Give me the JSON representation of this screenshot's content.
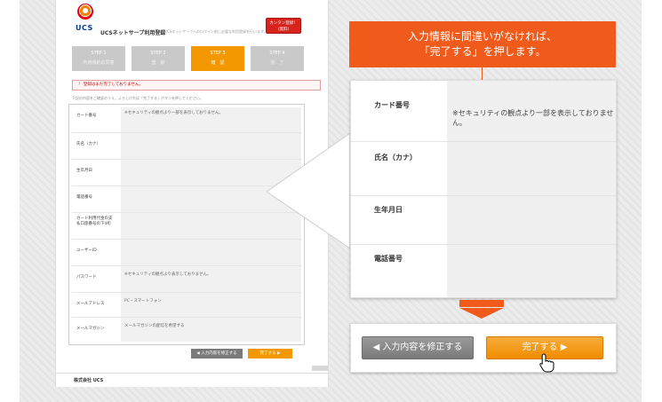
{
  "callout": {
    "line1": "入力情報に間違いがなければ、",
    "line2": "「完了する」を押します。"
  },
  "mini": {
    "logo_text": "UCS",
    "site_title": "UCSネットサーブ利用登録",
    "site_subtitle": "UCSネットサーブへのログイン前に必要な利用登録を行います。",
    "header_button": "カンタン登録！（無料）",
    "steps": [
      {
        "num": "STEP 1",
        "label": "利用規約の同意"
      },
      {
        "num": "STEP 2",
        "label": "登　録"
      },
      {
        "num": "STEP 3",
        "label": "確　認",
        "active": true
      },
      {
        "num": "STEP 4",
        "label": "完　了"
      }
    ],
    "alert": "！ 登録はまだ完了しておりません。",
    "note": "下記の内容をご確認のうえ、よろしければ「完了する」ボタンを押してください。",
    "rows": [
      {
        "label": "カード番号",
        "value": "※セキュリティの観点より一部を表示しておりません。"
      },
      {
        "label": "氏名（カナ）",
        "value": ""
      },
      {
        "label": "生年月日",
        "value": ""
      },
      {
        "label": "電話番号",
        "value": ""
      },
      {
        "label": "カード利用代金の支払口座番号の下4桁",
        "value": ""
      },
      {
        "label": "ユーザーID",
        "value": ""
      },
      {
        "label": "パスワード",
        "value": "※セキュリティの観点より表示しておりません。"
      },
      {
        "label": "メールアドレス",
        "value": "PC・スマートフォン"
      },
      {
        "label": "メールマガジン",
        "value": "メールマガジンの配信を希望する"
      }
    ],
    "btn_fix": "◀ 入力内容を修正する",
    "btn_done": "完了する ▶",
    "footer_logo": "株式会社 UCS"
  },
  "zoom": {
    "rows": [
      {
        "label": "カード番号",
        "value": "※セキュリティの観点より一部を表示しておりません。"
      },
      {
        "label": "氏名（カナ）",
        "value": ""
      },
      {
        "label": "生年月日",
        "value": ""
      },
      {
        "label": "電話番号",
        "value": ""
      }
    ]
  },
  "buttons": {
    "fix_label": "◀ 入力内容を修正する",
    "done_label": "完了する ▶"
  },
  "colors": {
    "accent_orange": "#f05a1a",
    "step_active": "#f39800",
    "button_gray": "#7a7a7a"
  }
}
